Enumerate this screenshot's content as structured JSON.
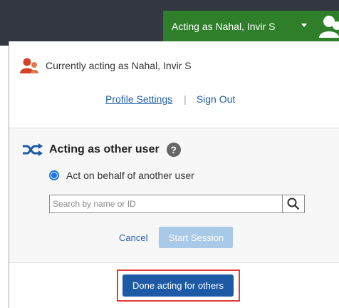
{
  "header": {
    "acting_label": "Acting as Nahal, Invir S",
    "pill_color": "#2f7f2a",
    "bar_color": "#333740",
    "dropdown_icon": "caret-down-icon",
    "avatar_icon": "user-avatar-icon"
  },
  "current_user": {
    "icon": "user-avatar-icon",
    "text": "Currently acting as Nahal, Invir S"
  },
  "links": {
    "profile_settings": "Profile Settings",
    "separator": "|",
    "sign_out": "Sign Out"
  },
  "other_user": {
    "icon": "shuffle-icon",
    "title": "Acting as other user",
    "help_glyph": "?",
    "radio_label": "Act on behalf of another user",
    "radio_selected": true,
    "search": {
      "placeholder": "Search by name or ID",
      "value": "",
      "icon": "search-icon"
    },
    "cancel_label": "Cancel",
    "start_label": "Start Session"
  },
  "done_label": "Done acting for others",
  "colors": {
    "link": "#1f5fa6",
    "primary_button": "#1c5aa6",
    "disabled_button": "#a9c9e8",
    "highlight_frame": "#e03b3b"
  }
}
